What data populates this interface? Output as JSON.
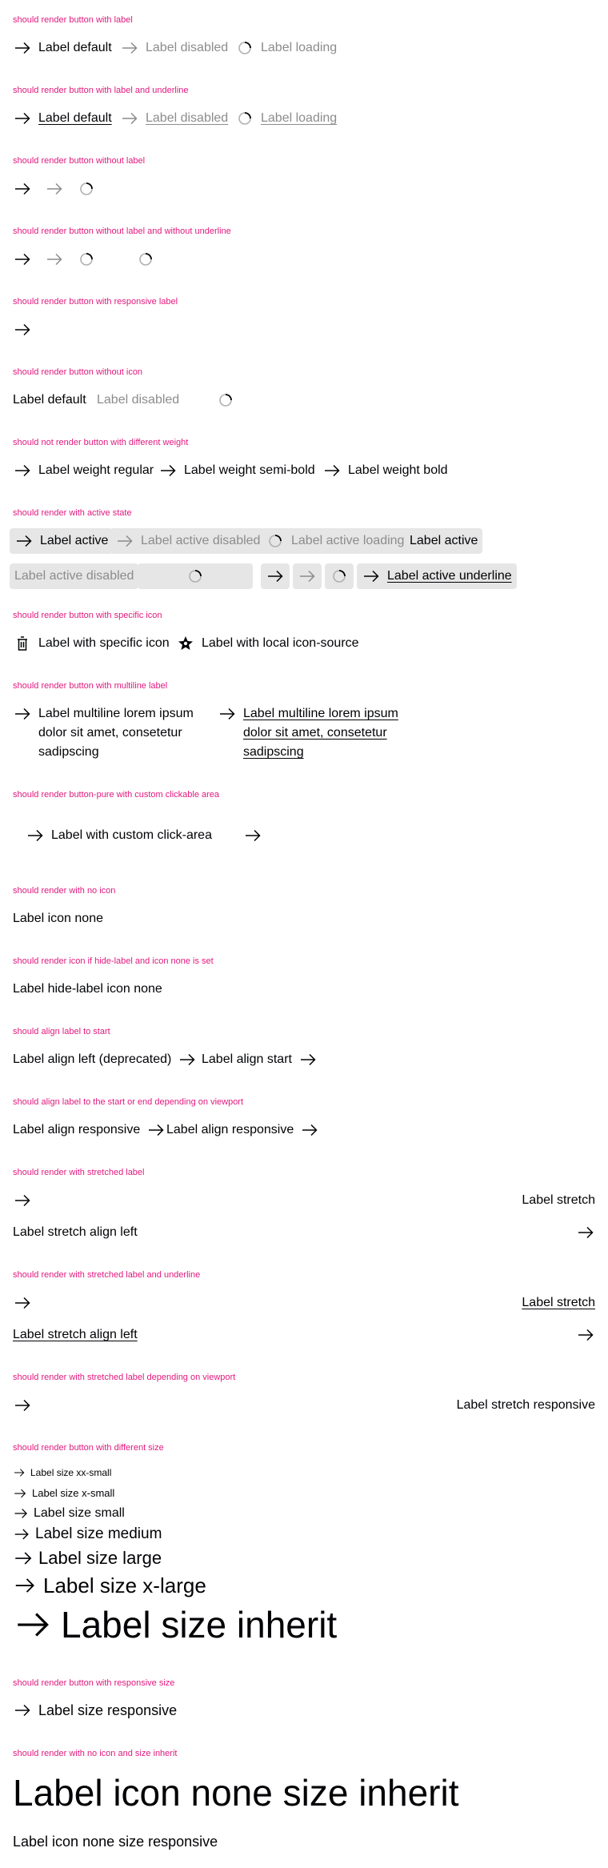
{
  "sections": {
    "label": {
      "title": "should render button with label",
      "items": [
        "Label default",
        "Label disabled",
        "Label loading"
      ]
    },
    "underline": {
      "title": "should render button with label and underline",
      "items": [
        "Label default",
        "Label disabled",
        "Label loading"
      ]
    },
    "nolabel": {
      "title": "should render button without label"
    },
    "nolabel_nounderline": {
      "title": "should render button without label and without underline"
    },
    "responsive_label": {
      "title": "should render button with responsive label"
    },
    "without_icon": {
      "title": "should render button without icon",
      "items": [
        "Label default",
        "Label disabled"
      ]
    },
    "weight": {
      "title": "should not render button with different weight",
      "items": [
        "Label weight regular",
        "Label weight semi-bold",
        "Label weight bold"
      ]
    },
    "active": {
      "title": "should render with active state",
      "items": [
        "Label active",
        "Label active disabled",
        "Label active loading",
        "Label active",
        "Label active disabled",
        "Label active underline"
      ]
    },
    "specific_icon": {
      "title": "should render button with specific icon",
      "items": [
        "Label with specific icon",
        "Label with local icon-source"
      ]
    },
    "multiline": {
      "title": "should render button with multiline label",
      "items": [
        "Label multiline lorem ipsum dolor sit amet, consetetur sadipscing",
        "Label multiline lorem ipsum dolor sit amet, consetetur sadipscing"
      ]
    },
    "click_area": {
      "title": "should render button-pure with custom clickable area",
      "items": [
        "Label with custom click-area"
      ]
    },
    "no_icon": {
      "title": "should render with no icon",
      "items": [
        "Label icon none"
      ]
    },
    "hide_label_icon_none": {
      "title": "should render icon if hide-label and icon none is set",
      "items": [
        "Label hide-label icon none"
      ]
    },
    "align_start": {
      "title": "should align label to start",
      "items": [
        "Label align left (deprecated)",
        "Label align start"
      ]
    },
    "align_responsive": {
      "title": "should align label to the start or end depending on viewport",
      "items": [
        "Label align responsive",
        "Label align responsive"
      ]
    },
    "stretch": {
      "title": "should render with stretched label",
      "items": [
        "Label stretch",
        "Label stretch align left"
      ]
    },
    "stretch_underline": {
      "title": "should render with stretched label and underline",
      "items": [
        "Label stretch",
        "Label stretch align left"
      ]
    },
    "stretch_responsive": {
      "title": "should render with stretched label depending on viewport",
      "items": [
        "Label stretch responsive"
      ]
    },
    "size": {
      "title": "should render button with different size",
      "items": [
        "Label size xx-small",
        "Label size x-small",
        "Label size small",
        "Label size medium",
        "Label size large",
        "Label size x-large",
        "Label size inherit"
      ]
    },
    "size_responsive": {
      "title": "should render button with responsive size",
      "items": [
        "Label size responsive"
      ]
    },
    "no_icon_size": {
      "title": "should render with no icon and size inherit",
      "items": [
        "Label icon none size inherit",
        "Label icon none size responsive"
      ]
    }
  },
  "colors": {
    "heading": "#e1197e",
    "text": "#010205",
    "disabled": "#8c8c8c",
    "active_bg": "#e6e6e6"
  },
  "icons": {
    "default": "arrow-right-icon",
    "loading": "spinner-icon",
    "specific": "delete-icon",
    "local": "star-icon"
  }
}
